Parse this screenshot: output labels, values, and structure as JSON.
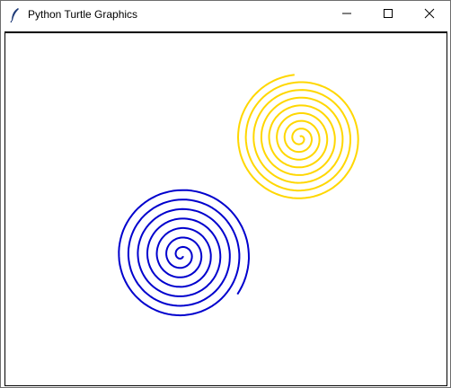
{
  "window": {
    "title": "Python Turtle Graphics",
    "icon": "feather-icon",
    "controls": [
      "minimize-icon",
      "maximize-icon",
      "close-icon"
    ]
  },
  "canvas": {
    "background": "#ffffff",
    "drawings": [
      {
        "name": "yellow-spiral",
        "color": "#ffd700",
        "turns": 8
      },
      {
        "name": "blue-spiral",
        "color": "#0000cd",
        "turns": 7
      }
    ]
  }
}
